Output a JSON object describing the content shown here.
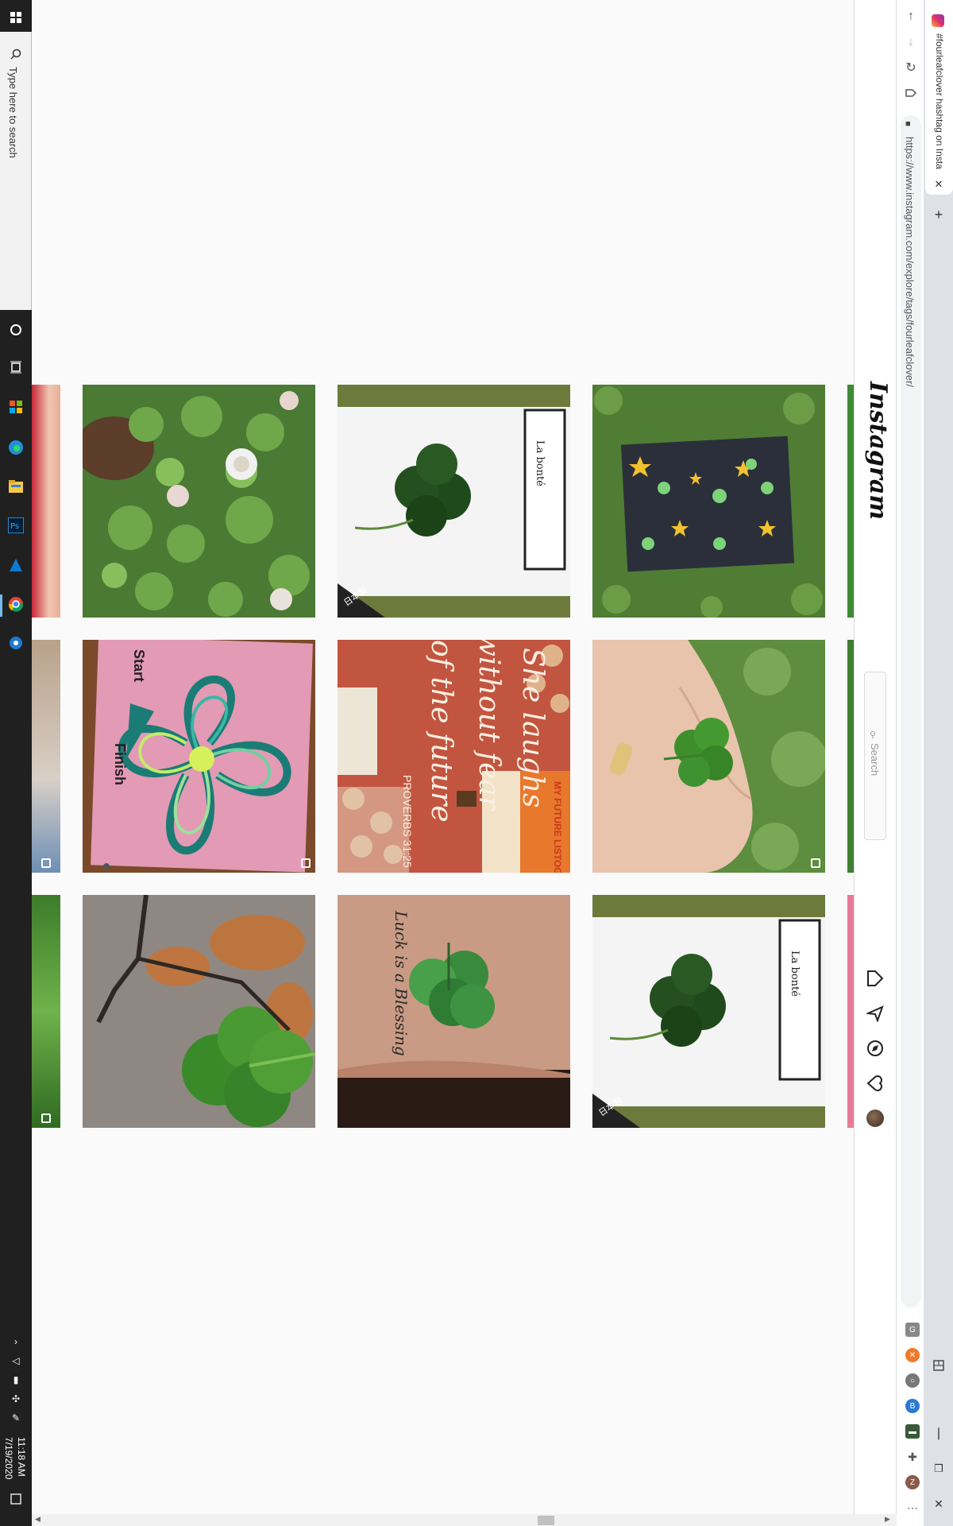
{
  "taskbar": {
    "search_placeholder": "Type here to search",
    "time": "11:18 AM",
    "date": "7/19/2020",
    "apps": [
      "start-icon",
      "cortana-icon",
      "task-view-icon",
      "store-icon",
      "edge-icon",
      "file-explorer-icon",
      "photoshop-icon",
      "azure-icon",
      "chrome-icon",
      "settings-icon"
    ]
  },
  "browser": {
    "tab_title": "#fourleafclover hashtag on Insta",
    "url": "https://www.instagram.com/explore/tags/fourleafclover/",
    "nav": [
      "back-icon",
      "forward-icon",
      "reload-icon",
      "tag-icon"
    ],
    "extensions": [
      "grammar-icon",
      "orange-ext-icon",
      "circle-ext-icon",
      "blue-ext-icon",
      "image-ext-icon",
      "puzzle-icon",
      "profile-icon"
    ],
    "profile_letter": "Z"
  },
  "instagram": {
    "logo": "Instagram",
    "search_placeholder": "Search",
    "nav_icons": [
      "home-icon",
      "direct-icon",
      "explore-icon",
      "activity-icon",
      "avatar"
    ]
  },
  "grid": {
    "posts": [
      {
        "row": 1,
        "col": 1,
        "subject": "clover-patch",
        "multi": false
      },
      {
        "row": 1,
        "col": 2,
        "subject": "pressed-clover-card",
        "multi": false
      },
      {
        "row": 1,
        "col": 3,
        "subject": "clover-star-card",
        "multi": false
      },
      {
        "row": 2,
        "col": 1,
        "subject": "clover-maze",
        "multi": true
      },
      {
        "row": 2,
        "col": 2,
        "subject": "proverbs-shirt",
        "multi": false
      },
      {
        "row": 2,
        "col": 3,
        "subject": "clover-in-hand",
        "multi": true
      },
      {
        "row": 3,
        "col": 1,
        "subject": "clover-on-rock",
        "multi": false
      },
      {
        "row": 3,
        "col": 2,
        "subject": "clover-tattoo",
        "multi": false
      },
      {
        "row": 3,
        "col": 3,
        "subject": "pressed-clover-card",
        "multi": false
      }
    ],
    "tile_text": {
      "maze_start": "Start",
      "maze_finish": "Finish",
      "shirt_line1": "She laughs",
      "shirt_line2": "without fear",
      "shirt_line3": "of the future",
      "shirt_ref": "PROVERBS 31:25",
      "book_title": "MY FUTURE LISTOGRAPHY",
      "card_brand": "La bonté",
      "card_origin": "日本製",
      "tattoo_text": "Luck is a Blessing"
    }
  }
}
